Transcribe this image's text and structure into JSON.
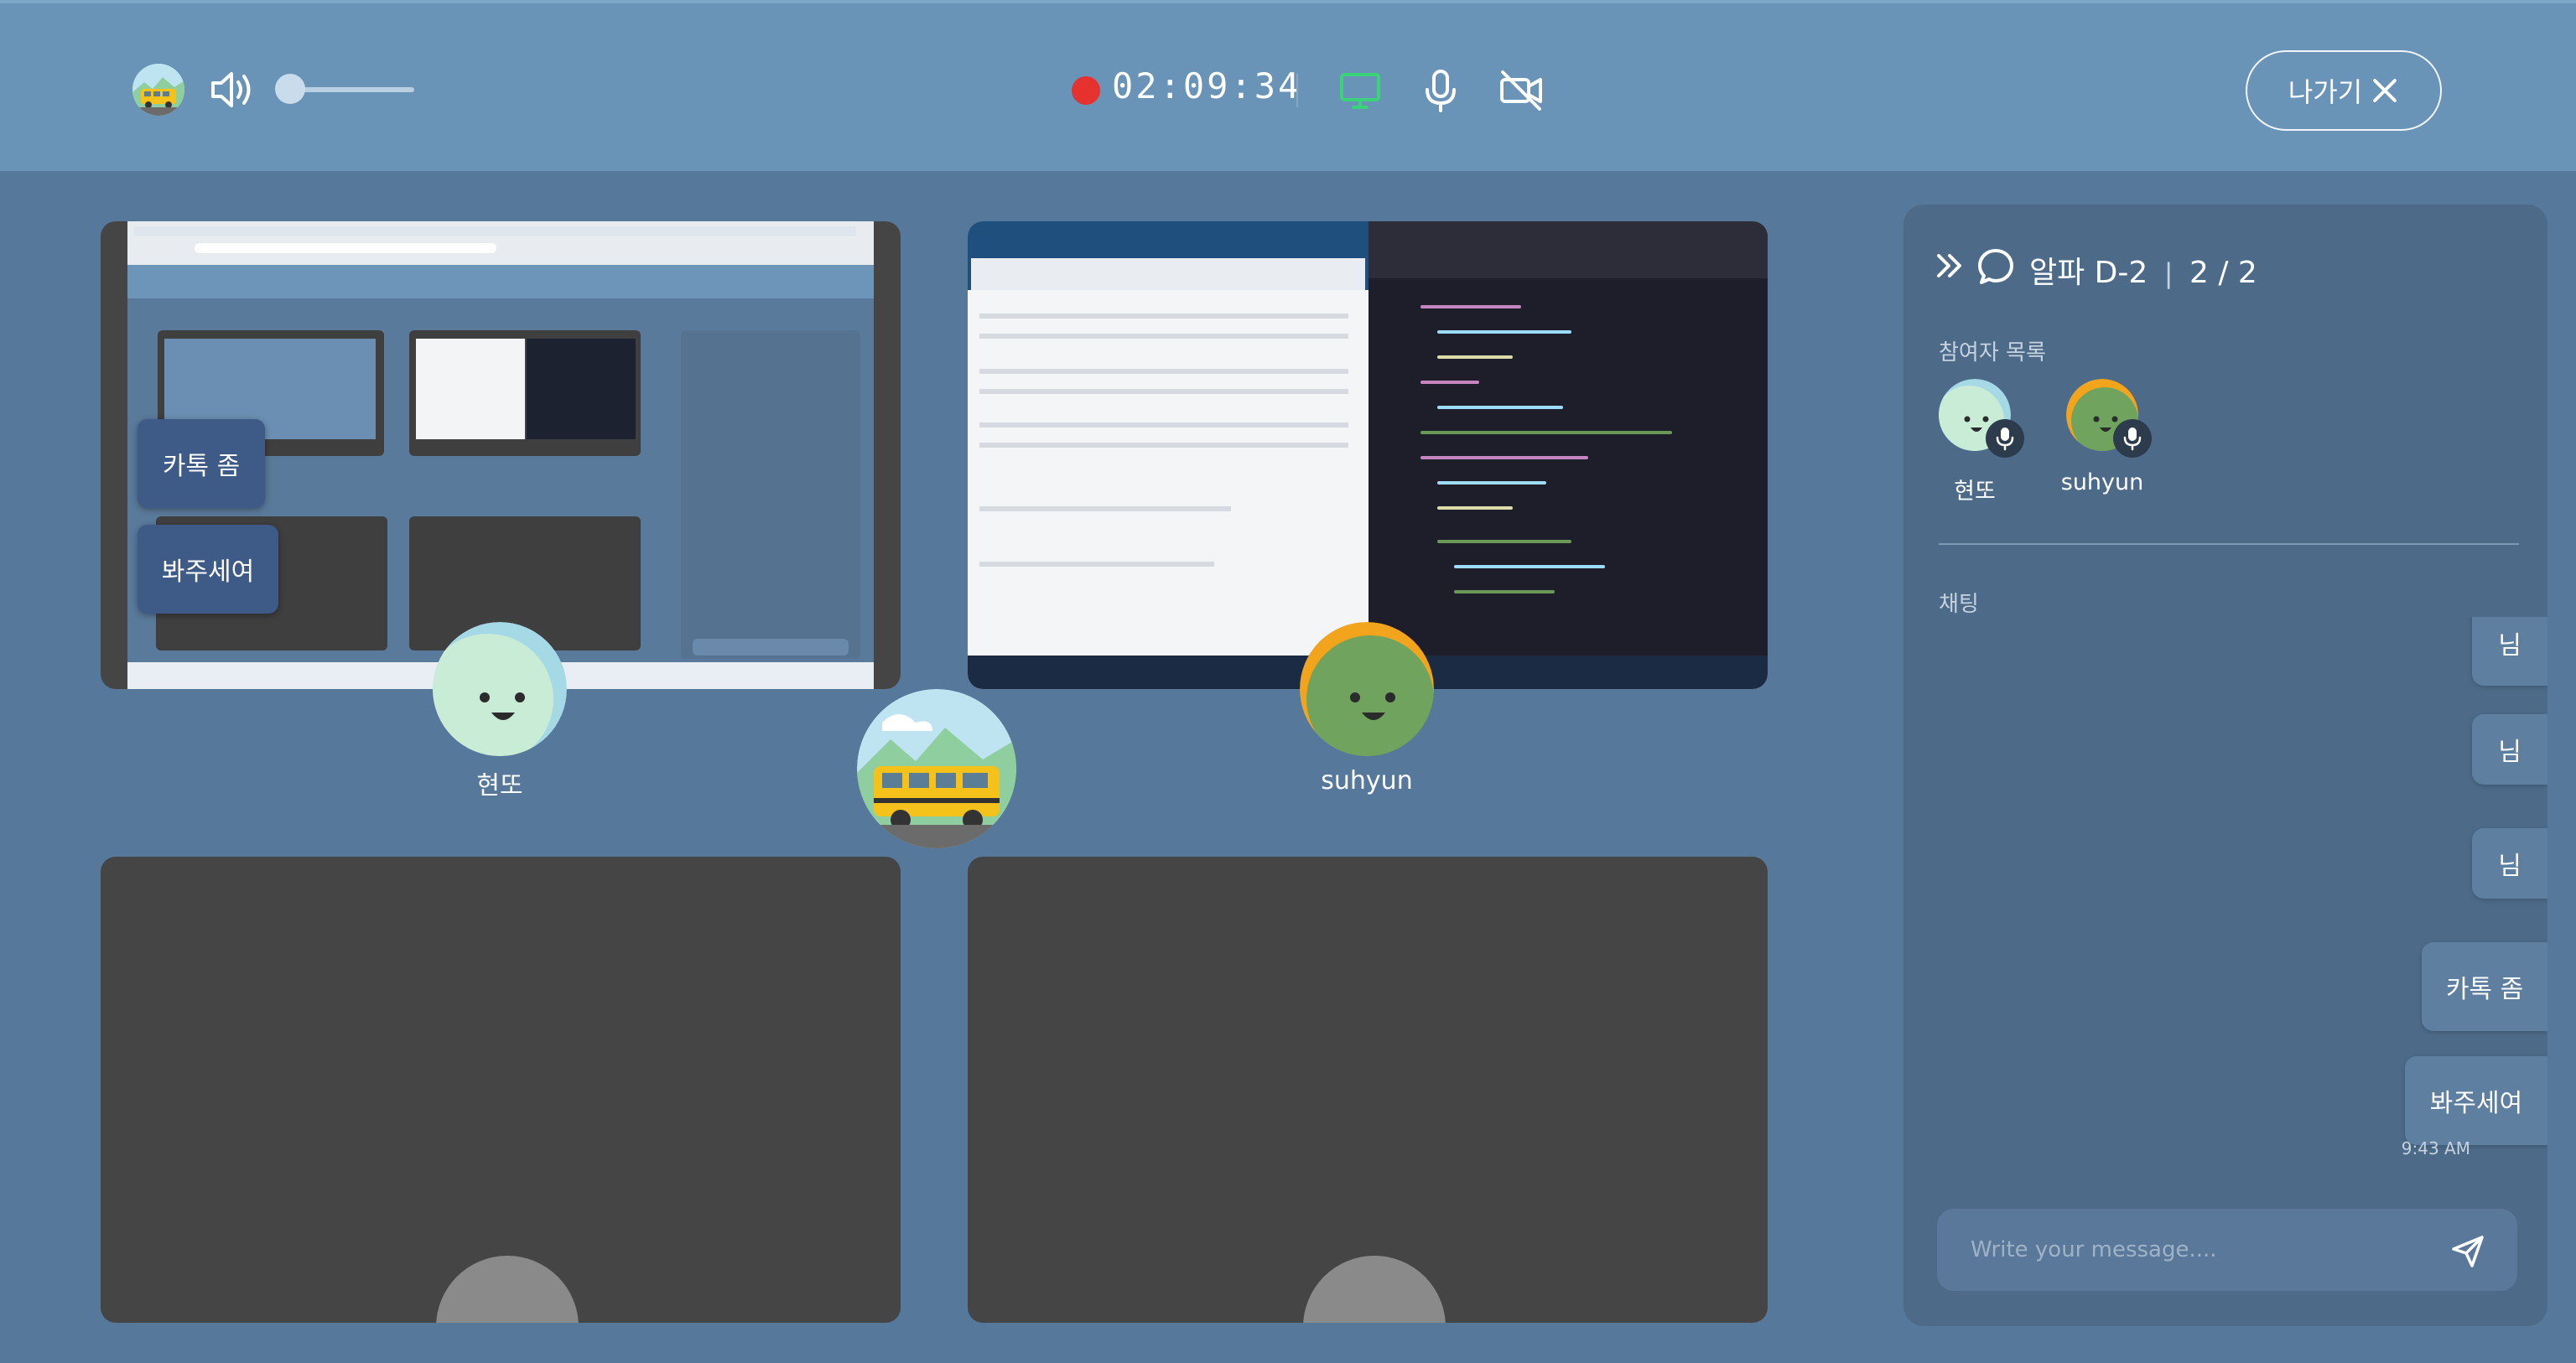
{
  "topbar": {
    "timer": "02:09:34",
    "exit_label": "나가기",
    "volume_level": 0.1
  },
  "stage": {
    "participants": [
      {
        "name": "현또"
      },
      {
        "name": "suhyun"
      }
    ],
    "overlay_buttons": [
      "카톡 좀",
      "봐주세여"
    ]
  },
  "panel": {
    "room_name": "알파 D-2",
    "count": "2 / 2",
    "participants_heading": "참여자 목록",
    "participants": [
      {
        "name": "현또"
      },
      {
        "name": "suhyun"
      }
    ],
    "chat_heading": "채팅",
    "messages": [
      "님",
      "님",
      "님",
      "카톡 좀",
      "봐주세여"
    ],
    "last_time": "9:43 AM",
    "input_placeholder": "Write your message...."
  },
  "colors": {
    "accent_rec": "#e5322e",
    "screen_share_icon": "#3bd37a",
    "face_green": "#6fa35e",
    "face_mint": "#c9ecd6",
    "face_orange": "#f2a51c"
  }
}
